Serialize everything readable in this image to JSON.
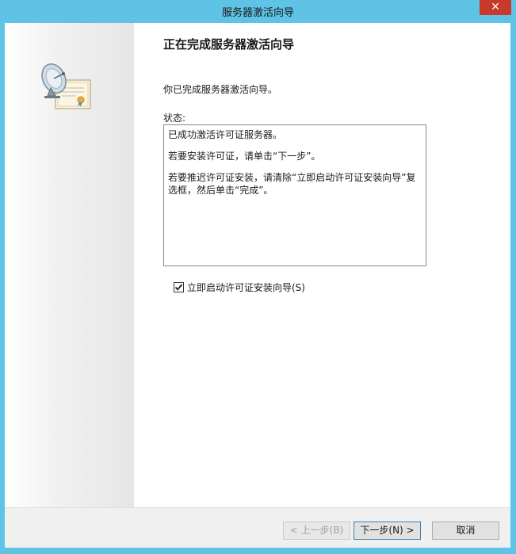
{
  "window": {
    "title": "服务器激活向导",
    "close_label": "✕"
  },
  "main": {
    "heading": "正在完成服务器激活向导",
    "intro": "你已完成服务器激活向导。",
    "status_label": "状态:",
    "status_lines": [
      "已成功激活许可证服务器。",
      "若要安装许可证，请单击“下一步”。",
      "若要推迟许可证安装，请清除“立即启动许可证安装向导”复选框，然后单击“完成”。"
    ],
    "checkbox": {
      "label": "立即启动许可证安装向导(S)",
      "checked": true
    }
  },
  "footer": {
    "back_label": "< 上一步(B)",
    "next_label": "下一步(N) >",
    "cancel_label": "取消"
  },
  "icons": {
    "wizard_icon": "satellite-dish-certificate-icon",
    "close_icon": "close-icon",
    "check_icon": "checkmark-icon"
  },
  "colors": {
    "title_bar": "#5fc3e6",
    "close_button": "#c7392b",
    "default_button_border": "#3c7fb1"
  }
}
